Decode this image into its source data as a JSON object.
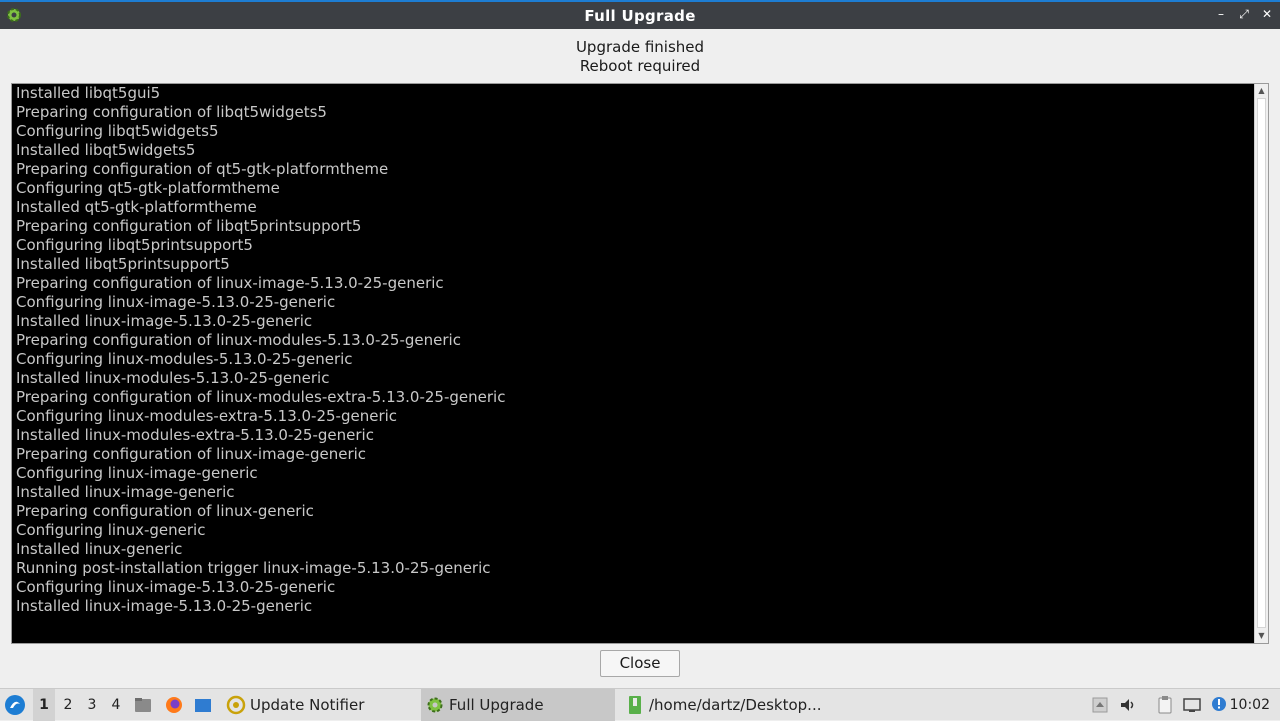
{
  "window": {
    "title": "Full Upgrade",
    "controls": {
      "minimize": "–",
      "maximize": "⤢",
      "close": "✕"
    }
  },
  "status": {
    "line1": "Upgrade finished",
    "line2": "Reboot required"
  },
  "log": {
    "lines": [
      "Installed libqt5gui5",
      "Preparing configuration of libqt5widgets5",
      "Configuring libqt5widgets5",
      "Installed libqt5widgets5",
      "Preparing configuration of qt5-gtk-platformtheme",
      "Configuring qt5-gtk-platformtheme",
      "Installed qt5-gtk-platformtheme",
      "Preparing configuration of libqt5printsupport5",
      "Configuring libqt5printsupport5",
      "Installed libqt5printsupport5",
      "Preparing configuration of linux-image-5.13.0-25-generic",
      "Configuring linux-image-5.13.0-25-generic",
      "Installed linux-image-5.13.0-25-generic",
      "Preparing configuration of linux-modules-5.13.0-25-generic",
      "Configuring linux-modules-5.13.0-25-generic",
      "Installed linux-modules-5.13.0-25-generic",
      "Preparing configuration of linux-modules-extra-5.13.0-25-generic",
      "Configuring linux-modules-extra-5.13.0-25-generic",
      "Installed linux-modules-extra-5.13.0-25-generic",
      "Preparing configuration of linux-image-generic",
      "Configuring linux-image-generic",
      "Installed linux-image-generic",
      "Preparing configuration of linux-generic",
      "Configuring linux-generic",
      "Installed linux-generic",
      "Running post-installation trigger linux-image-5.13.0-25-generic",
      "Configuring linux-image-5.13.0-25-generic",
      "Installed linux-image-5.13.0-25-generic"
    ]
  },
  "buttons": {
    "close_label": "Close"
  },
  "taskbar": {
    "desktops": [
      "1",
      "2",
      "3",
      "4"
    ],
    "tasks": [
      {
        "label": "Update Notifier",
        "icon": "update-notifier-icon"
      },
      {
        "label": "Full Upgrade",
        "icon": "gear-icon"
      },
      {
        "label": "/home/dartz/Desktop...",
        "icon": "terminal-icon"
      }
    ],
    "clock": "10:02"
  },
  "colors": {
    "titlebar": "#3c3f44",
    "accent": "#1d7dd3",
    "log_bg": "#000000",
    "log_text": "#c9c9c9"
  }
}
